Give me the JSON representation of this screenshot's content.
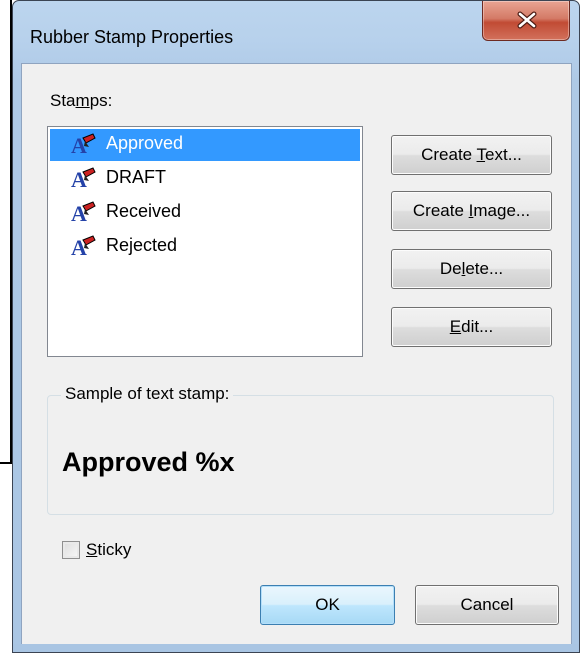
{
  "dialog": {
    "title": "Rubber Stamp Properties",
    "close_icon": "close-x-icon"
  },
  "stamps": {
    "label_pre": "Sta",
    "label_u": "m",
    "label_post": "ps:",
    "items": [
      {
        "label": "Approved",
        "selected": true
      },
      {
        "label": "DRAFT",
        "selected": false
      },
      {
        "label": "Received",
        "selected": false
      },
      {
        "label": "Rejected",
        "selected": false
      }
    ],
    "item_icon": "rubber-stamp-icon"
  },
  "buttons": {
    "create_text": {
      "pre": "Create ",
      "u": "T",
      "post": "ext..."
    },
    "create_image": {
      "pre": "Create ",
      "u": "I",
      "post": "mage..."
    },
    "delete": {
      "pre": "De",
      "u": "l",
      "post": "ete..."
    },
    "edit": {
      "pre": "",
      "u": "E",
      "post": "dit..."
    },
    "ok": "OK",
    "cancel": "Cancel"
  },
  "sample": {
    "legend": "Sample of text stamp:",
    "text": "Approved %x"
  },
  "sticky": {
    "u": "S",
    "post": "ticky",
    "checked": false
  },
  "colors": {
    "selection": "#3399ff",
    "close_button": "#c14b34",
    "frame": "#aec9e6"
  }
}
